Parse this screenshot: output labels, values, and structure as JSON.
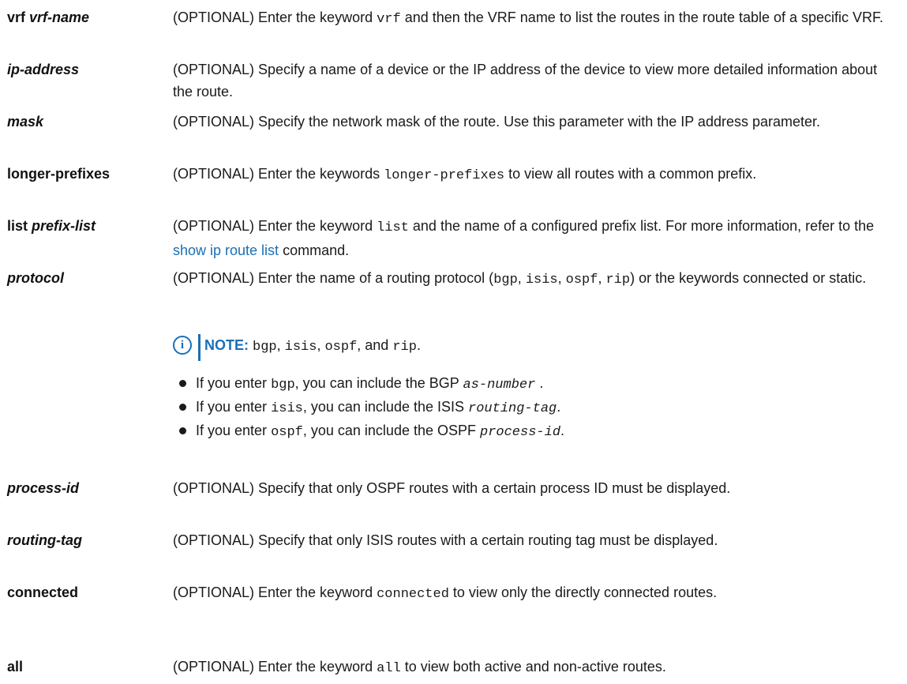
{
  "params": {
    "vrf": {
      "term_plain": "vrf ",
      "term_italic": "vrf-name",
      "desc_pre": "(OPTIONAL) Enter the keyword ",
      "desc_code": "vrf",
      "desc_post": " and then the VRF name to list the routes in the route table of a specific VRF."
    },
    "ip_address": {
      "term_italic": "ip-address",
      "desc": "(OPTIONAL) Specify a name of a device or the IP address of the device to view more detailed information about the route."
    },
    "mask": {
      "term_italic": "mask",
      "desc": "(OPTIONAL) Specify the network mask of the route. Use this parameter with the IP address parameter."
    },
    "longer_prefixes": {
      "term": "longer-prefixes",
      "desc_pre": "(OPTIONAL) Enter the keywords ",
      "desc_code": "longer-prefixes",
      "desc_post": " to view all routes with a common prefix."
    },
    "list": {
      "term_plain": "list ",
      "term_italic": "prefix-list",
      "desc_pre": "(OPTIONAL) Enter the keyword ",
      "desc_code": "list",
      "desc_mid": " and the name of a configured prefix list. For more information, refer to the ",
      "desc_link": "show ip route list",
      "desc_post": " command."
    },
    "protocol": {
      "term_italic": "protocol",
      "desc_pre": "(OPTIONAL) Enter the name of a routing protocol (",
      "code1": "bgp",
      "sep1": ", ",
      "code2": "isis",
      "sep2": ", ",
      "code3": "ospf",
      "sep3": ", ",
      "code4": "rip",
      "desc_post": ") or the keywords connected or static.",
      "note": {
        "icon": "info-icon",
        "label": "NOTE:",
        "code1": "bgp",
        "sep1": ", ",
        "code2": "isis",
        "sep2": ", ",
        "code3": "ospf",
        "sep3": ", and ",
        "code4": "rip",
        "end": "."
      },
      "bullets": [
        {
          "pre": "If you enter ",
          "code": "bgp",
          "mid": ", you can include the BGP ",
          "var": "as-number",
          "post": " ."
        },
        {
          "pre": "If you enter ",
          "code": "isis",
          "mid": ", you can include the ISIS ",
          "var": "routing-tag",
          "post": "."
        },
        {
          "pre": "If you enter ",
          "code": "ospf",
          "mid": ", you can include the OSPF ",
          "var": "process-id",
          "post": "."
        }
      ]
    },
    "process_id": {
      "term_italic": "process-id",
      "desc": "(OPTIONAL) Specify that only OSPF routes with a certain process ID must be displayed."
    },
    "routing_tag": {
      "term_italic": "routing-tag",
      "desc": "(OPTIONAL) Specify that only ISIS routes with a certain routing tag must be displayed."
    },
    "connected": {
      "term": "connected",
      "desc_pre": "(OPTIONAL) Enter the keyword ",
      "desc_code": "connected",
      "desc_post": " to view only the directly connected routes."
    },
    "all": {
      "term": "all",
      "desc_pre": "(OPTIONAL) Enter the keyword ",
      "desc_code": "all",
      "desc_post": " to view both active and non-active routes."
    }
  }
}
